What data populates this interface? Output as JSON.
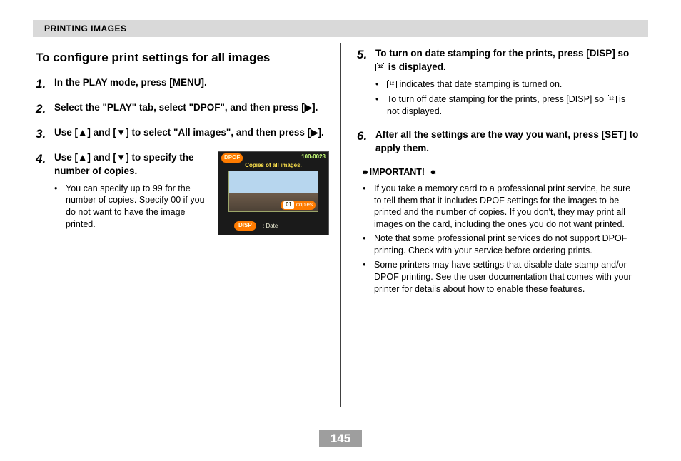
{
  "header": {
    "section": "PRINTING IMAGES"
  },
  "title": "To configure print settings for all images",
  "steps": {
    "s1": {
      "num": "1.",
      "main": "In the PLAY mode, press [MENU]."
    },
    "s2": {
      "num": "2.",
      "main": "Select the \"PLAY\" tab, select \"DPOF\", and then press [▶]."
    },
    "s3": {
      "num": "3.",
      "main": "Use [▲] and [▼] to select \"All images\", and then press [▶]."
    },
    "s4": {
      "num": "4.",
      "main": "Use [▲] and [▼] to specify the number of copies.",
      "sub1": "You can specify up to 99 for the number of copies. Specify 00 if you do not want to have the image printed."
    },
    "s5": {
      "num": "5.",
      "main_a": "To turn on date stamping for the prints, press [DISP] so ",
      "main_b": " is displayed.",
      "sub1_a": "",
      "sub1_b": " indicates that date stamping is turned on.",
      "sub2_a": "To turn off date stamping for the prints, press [DISP] so ",
      "sub2_b": " is not displayed."
    },
    "s6": {
      "num": "6.",
      "main": "After all the settings are the way you want, press [SET] to apply them."
    }
  },
  "lcd": {
    "dpof": "DPOF",
    "filecode": "100-0023",
    "subtitle": "Copies of all images.",
    "copies_val": "01",
    "copies_label": "copies",
    "disp": "DISP",
    "date": ": Date"
  },
  "important": {
    "label": "IMPORTANT!",
    "n1": "If you take a memory card to a professional print service, be sure to tell them that it includes DPOF settings for the images to be printed and the number of copies. If you don't, they may print all images on the card, including the ones you do not want printed.",
    "n2": "Note that some professional print services do not support DPOF printing. Check with your service before ordering prints.",
    "n3": "Some printers may have settings that disable date stamp and/or DPOF printing. See the user documentation that comes with your printer for details about how to enable these features."
  },
  "page_number": "145"
}
